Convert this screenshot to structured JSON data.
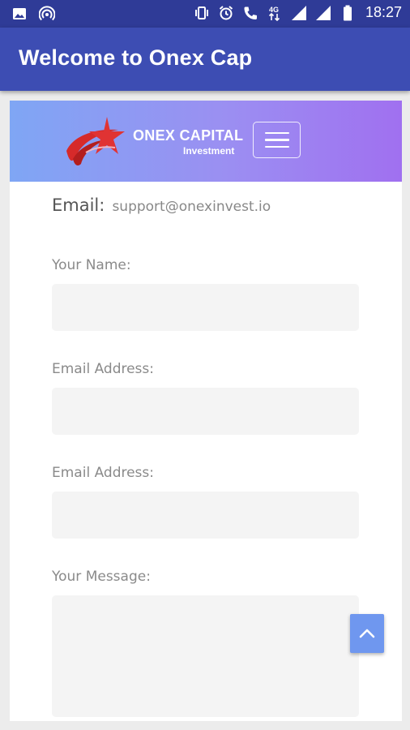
{
  "status_bar": {
    "left_icons": [
      "image-icon",
      "hotspot-icon"
    ],
    "right_icons": [
      "vibrate-icon",
      "alarm-icon",
      "call-icon",
      "data-arrows-icon",
      "signal-icon",
      "signal-icon",
      "battery-icon"
    ],
    "time": "18:27"
  },
  "app_bar": {
    "title": "Welcome to Onex Cap"
  },
  "banner": {
    "brand_name": "ONEX CAPITAL",
    "brand_sub": "Investment",
    "menu_icon": "hamburger-menu-icon"
  },
  "contact": {
    "email_label": "Email:",
    "email_value": "support@onexinvest.io"
  },
  "form": {
    "name_label": "Your Name:",
    "email_label": "Email Address:",
    "email2_label": "Email Address:",
    "message_label": "Your Message:"
  },
  "scroll_top": {
    "icon": "chevron-up-icon"
  }
}
